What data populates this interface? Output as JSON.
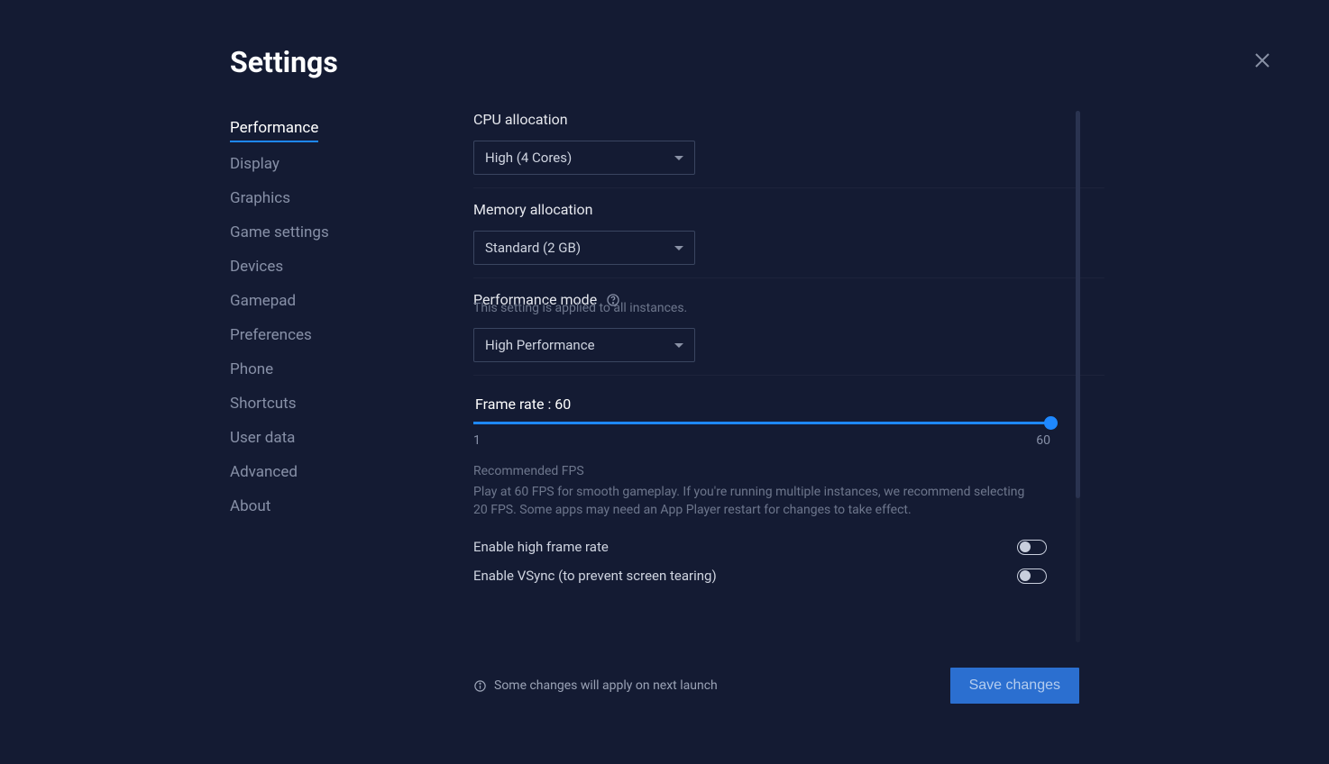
{
  "title": "Settings",
  "sidebar": {
    "items": [
      {
        "label": "Performance",
        "active": true
      },
      {
        "label": "Display"
      },
      {
        "label": "Graphics"
      },
      {
        "label": "Game settings"
      },
      {
        "label": "Devices"
      },
      {
        "label": "Gamepad"
      },
      {
        "label": "Preferences"
      },
      {
        "label": "Phone"
      },
      {
        "label": "Shortcuts"
      },
      {
        "label": "User data"
      },
      {
        "label": "Advanced"
      },
      {
        "label": "About"
      }
    ]
  },
  "cpu": {
    "label": "CPU allocation",
    "value": "High (4 Cores)"
  },
  "memory": {
    "label": "Memory allocation",
    "value": "Standard (2 GB)"
  },
  "perfmode": {
    "label": "Performance mode",
    "note": "This setting is applied to all instances.",
    "value": "High Performance"
  },
  "framerate": {
    "label": "Frame rate : 60",
    "min": "1",
    "max": "60",
    "recommended_title": "Recommended FPS",
    "recommended_body": "Play at 60 FPS for smooth gameplay. If you're running multiple instances, we recommend selecting 20 FPS. Some apps may need an App Player restart for changes to take effect."
  },
  "toggles": {
    "high_frame": "Enable high frame rate",
    "vsync": "Enable VSync (to prevent screen tearing)"
  },
  "footer": {
    "note": "Some changes will apply on next launch",
    "save": "Save changes"
  }
}
